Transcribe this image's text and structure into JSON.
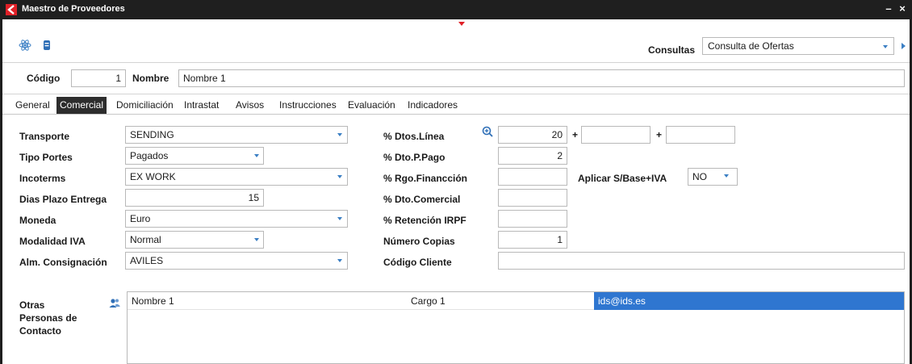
{
  "window": {
    "title": "Maestro de Proveedores",
    "minimize": "–",
    "close": "×"
  },
  "toolbar": {
    "icons": [
      "atom-icon",
      "database-icon"
    ],
    "consultas_label": "Consultas",
    "consultas_value": "Consulta de Ofertas"
  },
  "header": {
    "codigo_label": "Código",
    "codigo_value": "1",
    "nombre_label": "Nombre",
    "nombre_value": "Nombre 1"
  },
  "tabs": [
    {
      "label": "General",
      "active": false
    },
    {
      "label": "Comercial",
      "active": true
    },
    {
      "label": "Domiciliación",
      "active": false
    },
    {
      "label": "Intrastat",
      "active": false
    },
    {
      "label": "Avisos",
      "active": false
    },
    {
      "label": "Instrucciones",
      "active": false
    },
    {
      "label": "Evaluación",
      "active": false
    },
    {
      "label": "Indicadores",
      "active": false
    }
  ],
  "left": {
    "transporte": {
      "label": "Transporte",
      "value": "SENDING"
    },
    "tipo_portes": {
      "label": "Tipo Portes",
      "value": "Pagados"
    },
    "incoterms": {
      "label": "Incoterms",
      "value": "EX WORK"
    },
    "dias_plazo": {
      "label": "Dias Plazo Entrega",
      "value": "15"
    },
    "moneda": {
      "label": "Moneda",
      "value": "Euro"
    },
    "modalidad_iva": {
      "label": "Modalidad IVA",
      "value": "Normal"
    },
    "alm_consignacion": {
      "label": "Alm. Consignación",
      "value": "AVILES"
    }
  },
  "right": {
    "dtos_linea": {
      "label": "% Dtos.Línea",
      "value1": "20",
      "value2": "",
      "value3": "",
      "plus": "+"
    },
    "dto_ppago": {
      "label": "% Dto.P.Pago",
      "value": "2"
    },
    "rgo_financ": {
      "label": "% Rgo.Financción",
      "value": ""
    },
    "aplicar": {
      "label": "Aplicar S/Base+IVA",
      "value": "NO"
    },
    "dto_comercial": {
      "label": "% Dto.Comercial",
      "value": ""
    },
    "retencion": {
      "label": "% Retención IRPF",
      "value": ""
    },
    "num_copias": {
      "label": "Número Copias",
      "value": "1"
    },
    "codigo_cliente": {
      "label": "Código Cliente",
      "value": ""
    }
  },
  "contacts": {
    "label_line1": "Otras",
    "label_line2": "Personas de",
    "label_line3": "Contacto",
    "rows": [
      {
        "nombre": "Nombre 1",
        "cargo": "Cargo 1",
        "email": "ids@ids.es"
      }
    ]
  },
  "colors": {
    "accent": "#2f76d0",
    "brand": "#e02027",
    "titlebar": "#1f1f1f"
  }
}
